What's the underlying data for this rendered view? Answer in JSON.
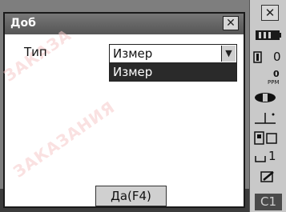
{
  "dialog": {
    "title": "Доб",
    "close_glyph": "✕",
    "type_label": "Тип",
    "combo_value": "Измер",
    "dropdown_options": [
      "Измер"
    ],
    "ok_button": "Да(F4)",
    "watermark_line1": "ЗАКАЗА",
    "watermark_line2": "ЗАКАЗАНИЯ"
  },
  "statusbar": {
    "close_glyph": "✕",
    "offset_value": "0",
    "ppm_value": "0",
    "ppm_unit": "PPM",
    "laser_level": "1",
    "mode_indicator": "C1"
  },
  "icons": [
    "battery-icon",
    "prism-icon",
    "ppm-icon",
    "laser-pointer-icon",
    "plummet-icon",
    "target-icon",
    "level-icon",
    "edit-icon",
    "dropdown-arrow-icon",
    "close-icon"
  ]
}
